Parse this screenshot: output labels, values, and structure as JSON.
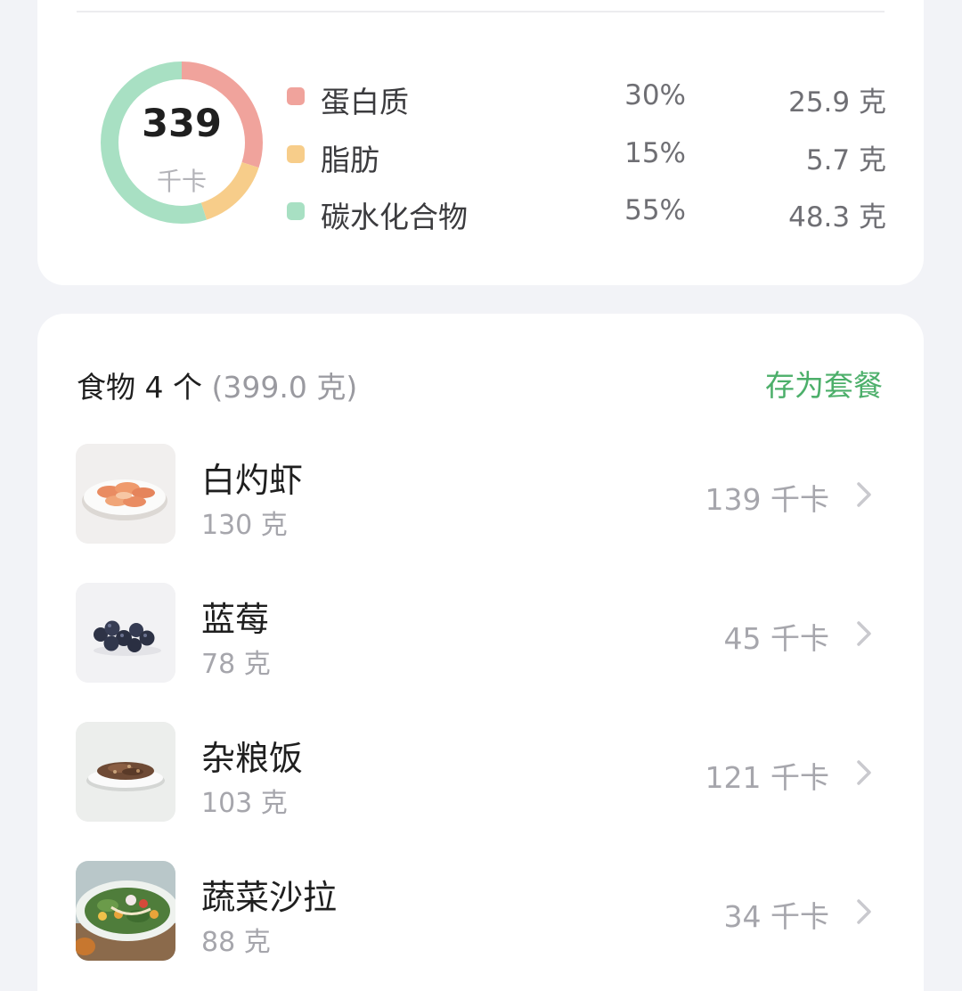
{
  "summary": {
    "total_calories": "339",
    "calorie_unit": "千卡",
    "macros": [
      {
        "name": "蛋白质",
        "percent": "30%",
        "grams": "25.9 克",
        "color": "#f0a39c",
        "share": 0.3
      },
      {
        "name": "脂肪",
        "percent": "15%",
        "grams": "5.7 克",
        "color": "#f7cd8a",
        "share": 0.15
      },
      {
        "name": "碳水化合物",
        "percent": "55%",
        "grams": "48.3 克",
        "color": "#a8e0c3",
        "share": 0.55
      }
    ]
  },
  "food_list": {
    "count_label": "食物 4 个",
    "total_weight": "(399.0 克)",
    "save_action": "存为套餐",
    "accent_color": "#4caf6a",
    "items": [
      {
        "name": "白灼虾",
        "grams": "130 克",
        "calories": "139 千卡",
        "thumb": "shrimp-plate"
      },
      {
        "name": "蓝莓",
        "grams": "78 克",
        "calories": "45 千卡",
        "thumb": "blueberries"
      },
      {
        "name": "杂粮饭",
        "grams": "103 克",
        "calories": "121 千卡",
        "thumb": "grain-rice-plate"
      },
      {
        "name": "蔬菜沙拉",
        "grams": "88 克",
        "calories": "34 千卡",
        "thumb": "vegetable-salad"
      }
    ]
  }
}
